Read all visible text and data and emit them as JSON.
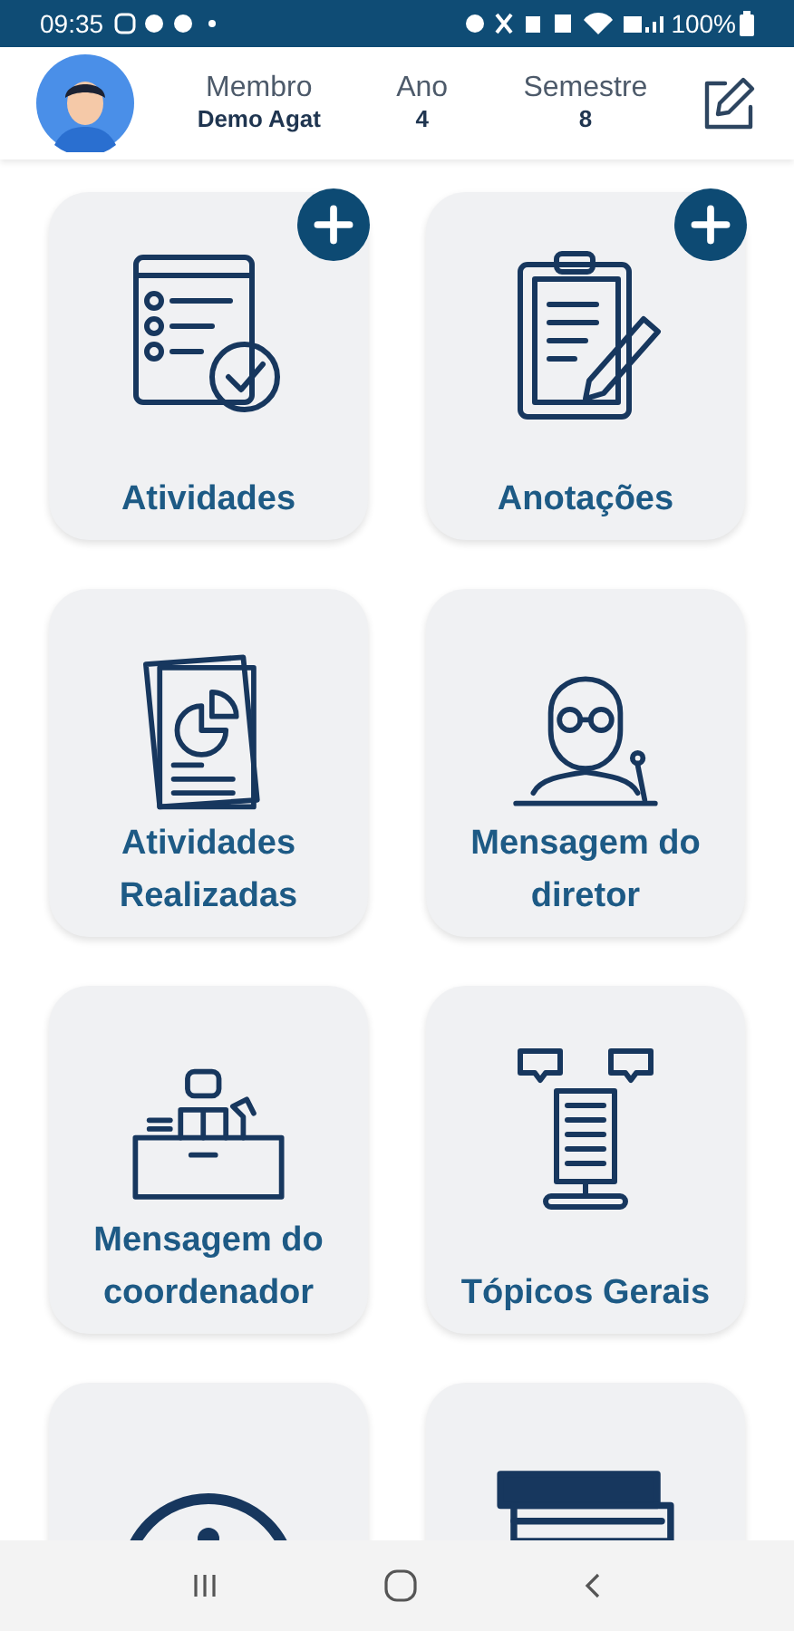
{
  "status_bar": {
    "time": "09:35",
    "battery": "100%"
  },
  "header": {
    "fields": [
      {
        "label": "Membro",
        "value": "Demo Agat"
      },
      {
        "label": "Ano",
        "value": "4"
      },
      {
        "label": "Semestre",
        "value": "8"
      }
    ]
  },
  "cards": [
    {
      "label": "Atividades",
      "add": true
    },
    {
      "label": "Anotações",
      "add": true
    },
    {
      "label": "Atividades Realizadas",
      "add": false
    },
    {
      "label": "Mensagem do diretor",
      "add": false
    },
    {
      "label": "Mensagem do coordenador",
      "add": false
    },
    {
      "label": "Tópicos Gerais",
      "add": false
    },
    {
      "add": false
    },
    {
      "add": false
    }
  ]
}
